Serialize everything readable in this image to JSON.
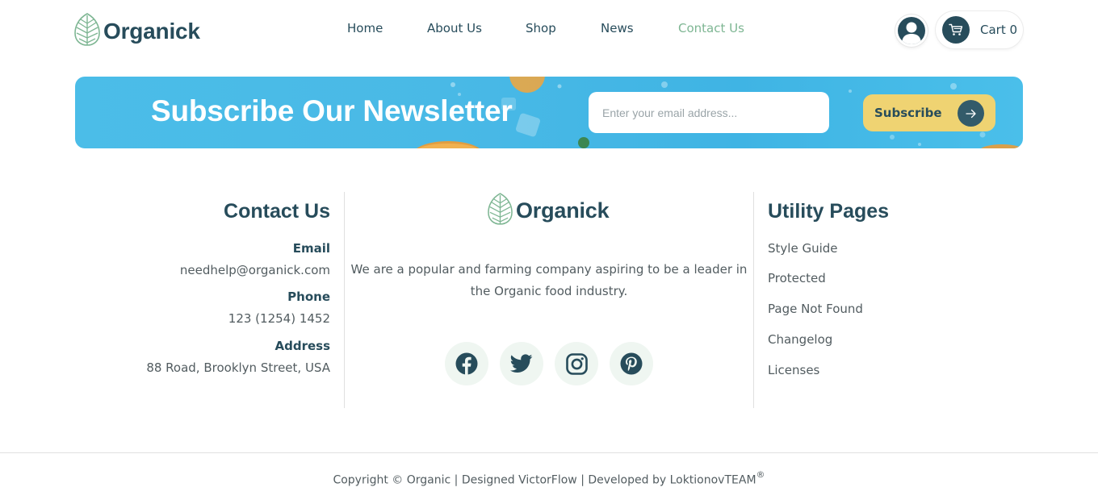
{
  "header": {
    "logo_text": "Organick",
    "nav": [
      {
        "label": "Home"
      },
      {
        "label": "About Us"
      },
      {
        "label": "Shop"
      },
      {
        "label": "News"
      },
      {
        "label": "Contact Us",
        "active": true
      }
    ],
    "cart_label": "Cart 0"
  },
  "newsletter": {
    "title": "Subscribe Our Newsletter",
    "email_placeholder": "Enter your email address...",
    "subscribe_label": "Subscribe"
  },
  "contact": {
    "heading": "Contact Us",
    "email_label": "Email",
    "email_value": "needhelp@organick.com",
    "phone_label": "Phone",
    "phone_value": "123 (1254) 1452",
    "address_label": "Address",
    "address_value": "88 Road, Brooklyn Street, USA"
  },
  "about": {
    "logo_text": "Organick",
    "description": "We are a popular and farming company aspiring to be a leader in the Organic food industry.",
    "socials": [
      "facebook-icon",
      "twitter-icon",
      "instagram-icon",
      "pinterest-icon"
    ]
  },
  "utility": {
    "heading": "Utility Pages",
    "links": [
      "Style Guide",
      "Protected",
      "Page Not Found",
      "Changelog",
      "Licenses"
    ]
  },
  "footer": {
    "copyright": "Copyright © Organic | Designed VictorFlow | Developed by LoktionovTEAM",
    "trademark": "®"
  },
  "colors": {
    "primary": "#274c5b",
    "accent_green": "#7eb693",
    "accent_yellow": "#efd372",
    "banner_blue": "#49b9e6"
  }
}
